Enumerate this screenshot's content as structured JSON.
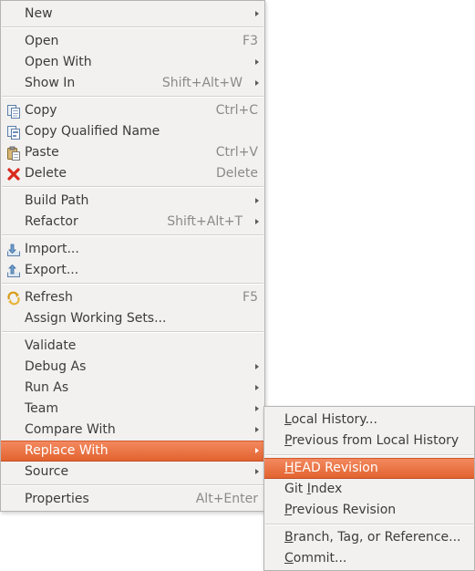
{
  "main_menu": {
    "new": {
      "label": "New"
    },
    "open": {
      "label": "Open",
      "shortcut": "F3"
    },
    "open_with": {
      "label": "Open With"
    },
    "show_in": {
      "label": "Show In",
      "shortcut": "Shift+Alt+W"
    },
    "copy": {
      "label": "Copy",
      "shortcut": "Ctrl+C",
      "icon": "copy-icon"
    },
    "copy_qualified_name": {
      "label": "Copy Qualified Name",
      "icon": "copy-qualified-name-icon"
    },
    "paste": {
      "label": "Paste",
      "shortcut": "Ctrl+V",
      "icon": "paste-icon"
    },
    "delete": {
      "label": "Delete",
      "shortcut": "Delete",
      "icon": "delete-icon"
    },
    "build_path": {
      "label": "Build Path"
    },
    "refactor": {
      "label": "Refactor",
      "shortcut": "Shift+Alt+T"
    },
    "import": {
      "label": "Import...",
      "icon": "import-icon"
    },
    "export": {
      "label": "Export...",
      "icon": "export-icon"
    },
    "refresh": {
      "label": "Refresh",
      "shortcut": "F5",
      "icon": "refresh-icon"
    },
    "assign_working_sets": {
      "label": "Assign Working Sets..."
    },
    "validate": {
      "label": "Validate"
    },
    "debug_as": {
      "label": "Debug As"
    },
    "run_as": {
      "label": "Run As"
    },
    "team": {
      "label": "Team"
    },
    "compare_with": {
      "label": "Compare With"
    },
    "replace_with": {
      "label": "Replace With"
    },
    "source": {
      "label": "Source"
    },
    "properties": {
      "label": "Properties",
      "shortcut": "Alt+Enter"
    }
  },
  "replace_with_submenu": {
    "local_history": {
      "mnemonic": "L",
      "rest": "ocal History..."
    },
    "previous_from_local_history": {
      "mnemonic": "P",
      "rest": "revious from Local History"
    },
    "head_revision": {
      "mnemonic": "H",
      "rest": "EAD Revision"
    },
    "git_index": {
      "before": "Git ",
      "mnemonic": "I",
      "rest": "ndex"
    },
    "previous_revision": {
      "mnemonic": "P",
      "rest": "revious Revision"
    },
    "branch_tag_reference": {
      "mnemonic": "B",
      "rest": "ranch, Tag, or Reference..."
    },
    "commit": {
      "mnemonic": "C",
      "rest": "ommit..."
    }
  },
  "colors": {
    "menu_background": "#f2f1f0",
    "highlight": "#e9692f",
    "delete_icon": "#d9281d"
  }
}
